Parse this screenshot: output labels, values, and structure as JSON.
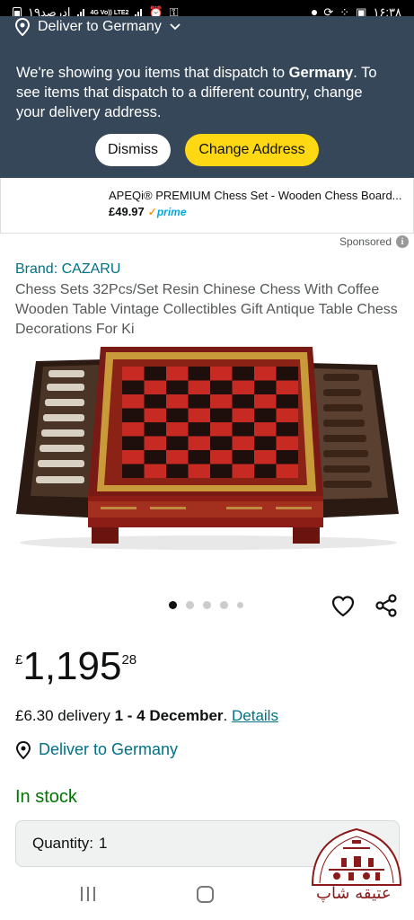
{
  "status_bar": {
    "time": "۱۶:۳۸",
    "left_text": "۱۹ادرصد",
    "network": "4G Vo)) LTE2"
  },
  "banner": {
    "deliver_label": "Deliver to Germany",
    "message_before": "We're showing you items that dispatch to ",
    "message_country": "Germany",
    "message_after": ". To see items that dispatch to a different country, change your delivery address.",
    "dismiss_label": "Dismiss",
    "change_label": "Change Address"
  },
  "ad": {
    "title": "APEQi® PREMIUM Chess Set - Wooden Chess Board...",
    "price": "£49.97",
    "prime_label": "prime",
    "sponsored_label": "Sponsored",
    "info_glyph": "i"
  },
  "product": {
    "brand": "Brand: CAZARU",
    "title": "Chess Sets 32Pcs/Set Resin Chinese Chess With Coffee Wooden Table Vintage Collectibles Gift Antique Table Chess Decorations For Ki",
    "image_count": 5,
    "active_image": 1
  },
  "price": {
    "currency": "£",
    "whole": "1,195",
    "fraction": "28"
  },
  "delivery": {
    "cost": "£6.30 delivery ",
    "dates": "1 - 4 December",
    "period": ". ",
    "details_link": "Details"
  },
  "deliver_to": "Deliver to Germany",
  "stock": "In stock",
  "quantity": {
    "label": "Quantity:",
    "value": "1"
  },
  "watermark": {
    "text": "عتیقه شاپ"
  },
  "colors": {
    "banner_bg": "#37475a",
    "change_button": "#ffd814",
    "link": "#007185",
    "in_stock": "#007600"
  }
}
